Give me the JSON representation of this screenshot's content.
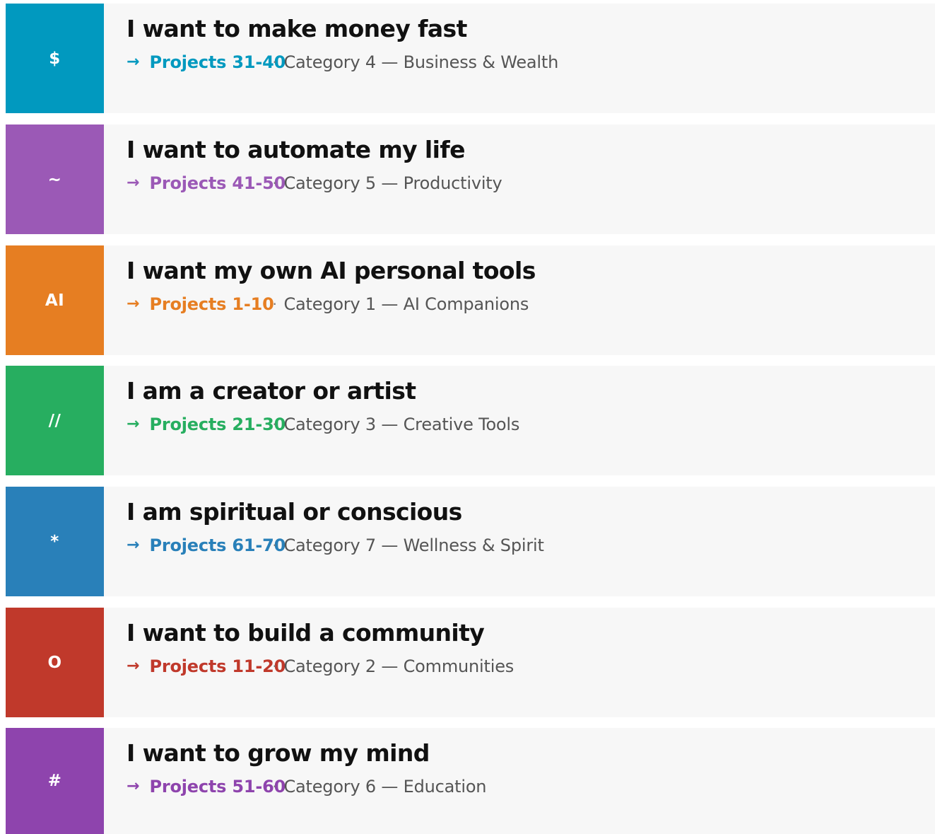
{
  "cards": [
    {
      "icon": "$",
      "icon_name": "dollar-icon",
      "color": "#0199bf",
      "title": "I want to make money fast",
      "arrow": "→",
      "projects": "Projects 31-40",
      "separator": "·",
      "category": "Category 4 — Business & Wealth"
    },
    {
      "icon": "~",
      "icon_name": "tilde-icon",
      "color": "#9b59b6",
      "title": "I want to automate my life",
      "arrow": "→",
      "projects": "Projects 41-50",
      "separator": "·",
      "category": "Category 5 — Productivity"
    },
    {
      "icon": "AI",
      "icon_name": "ai-icon",
      "color": "#e67e22",
      "title": "I want my own AI personal tools",
      "arrow": "→",
      "projects": "Projects 1-10",
      "separator": "·",
      "category": "Category 1 — AI Companions"
    },
    {
      "icon": "//",
      "icon_name": "slashes-icon",
      "color": "#27ae60",
      "title": "I am a creator or artist",
      "arrow": "→",
      "projects": "Projects 21-30",
      "separator": "·",
      "category": "Category 3 — Creative Tools"
    },
    {
      "icon": "*",
      "icon_name": "asterisk-icon",
      "color": "#2980b9",
      "title": "I am spiritual or conscious",
      "arrow": "→",
      "projects": "Projects 61-70",
      "separator": "·",
      "category": "Category 7 — Wellness & Spirit"
    },
    {
      "icon": "O",
      "icon_name": "circle-letter-icon",
      "color": "#c0392b",
      "title": "I want to build a community",
      "arrow": "→",
      "projects": "Projects 11-20",
      "separator": "·",
      "category": "Category 2 — Communities"
    },
    {
      "icon": "#",
      "icon_name": "hash-icon",
      "color": "#8e44ad",
      "title": "I want to grow my mind",
      "arrow": "→",
      "projects": "Projects 51-60",
      "separator": "·",
      "category": "Category 6 — Education"
    }
  ]
}
